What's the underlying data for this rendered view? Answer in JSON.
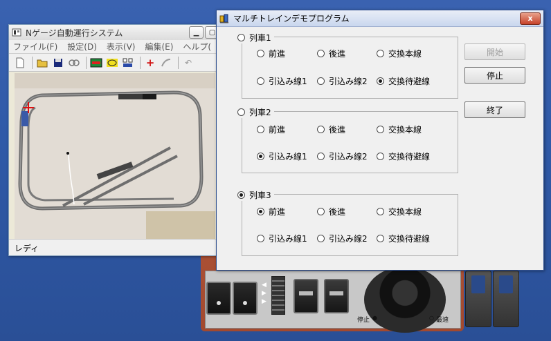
{
  "back_window": {
    "title": "Nゲージ自動運行システム",
    "menu": [
      "ファイル(F)",
      "設定(D)",
      "表示(V)",
      "編集(E)",
      "ヘルプ("
    ],
    "status": "レディ"
  },
  "dialog": {
    "title": "マルチトレインデモプログラム",
    "close_label": "x",
    "groups": [
      {
        "label": "列車1",
        "selected": false,
        "options": [
          {
            "label": "前進",
            "checked": false
          },
          {
            "label": "後進",
            "checked": false
          },
          {
            "label": "交換本線",
            "checked": false
          },
          {
            "label": "引込み線1",
            "checked": false
          },
          {
            "label": "引込み線2",
            "checked": false
          },
          {
            "label": "交換待避線",
            "checked": true
          }
        ]
      },
      {
        "label": "列車2",
        "selected": false,
        "options": [
          {
            "label": "前進",
            "checked": false
          },
          {
            "label": "後進",
            "checked": false
          },
          {
            "label": "交換本線",
            "checked": false
          },
          {
            "label": "引込み線1",
            "checked": true
          },
          {
            "label": "引込み線2",
            "checked": false
          },
          {
            "label": "交換待避線",
            "checked": false
          }
        ]
      },
      {
        "label": "列車3",
        "selected": true,
        "options": [
          {
            "label": "前進",
            "checked": true
          },
          {
            "label": "後進",
            "checked": false
          },
          {
            "label": "交換本線",
            "checked": false
          },
          {
            "label": "引込み線1",
            "checked": false
          },
          {
            "label": "引込み線2",
            "checked": false
          },
          {
            "label": "交換待避線",
            "checked": false
          }
        ]
      }
    ],
    "buttons": {
      "start": "開始",
      "stop": "停止",
      "exit": "終了"
    }
  },
  "console": {
    "stop_label": "停止",
    "max_speed_label": "最速"
  }
}
